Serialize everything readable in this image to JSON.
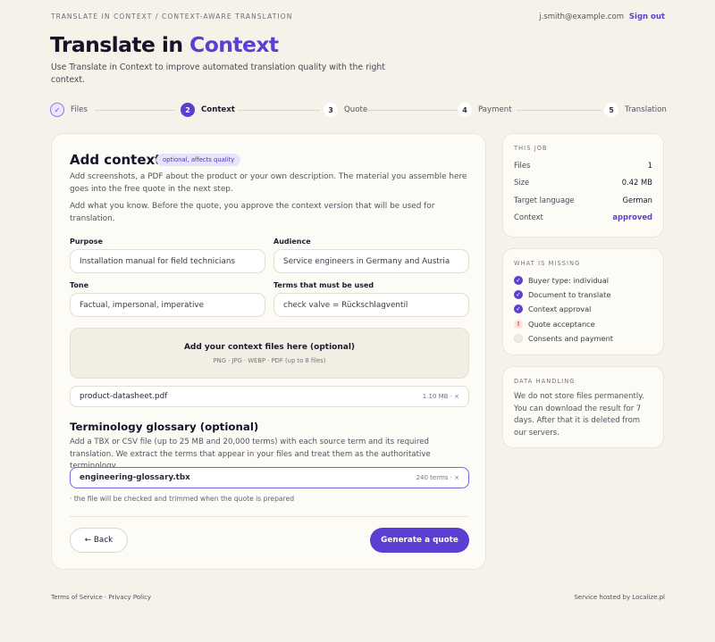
{
  "header": {
    "breadcrumb": "TRANSLATE IN CONTEXT / CONTEXT-AWARE TRANSLATION",
    "email": "j.smith@example.com",
    "signout": "Sign out"
  },
  "title": {
    "part1": "Translate in ",
    "part2": "Context"
  },
  "lede": "Use Translate in Context to improve automated translation quality with the right context.",
  "steps": [
    {
      "num": "✓",
      "label": "Files",
      "state": "done"
    },
    {
      "num": "2",
      "label": "Context",
      "state": "active"
    },
    {
      "num": "3",
      "label": "Quote",
      "state": "todo"
    },
    {
      "num": "4",
      "label": "Payment",
      "state": "todo"
    },
    {
      "num": "5",
      "label": "Translation",
      "state": "todo"
    }
  ],
  "form": {
    "heading": "Add context",
    "pill": "optional, affects quality",
    "intro1": "Add screenshots, a PDF about the product or your own description. The material you assemble here goes into the free quote in the next step.",
    "intro2": "Add what you know. Before the quote, you approve the context version that will be used for translation.",
    "purpose_label": "Purpose",
    "purpose_value": "Installation manual for field technicians",
    "audience_label": "Audience",
    "audience_value": "Service engineers in Germany and Austria",
    "tone_label": "Tone",
    "tone_value": "Factual, impersonal, imperative",
    "terms_label": "Terms that must be used",
    "terms_value": "check valve = Rückschlagventil",
    "drop_title": "Add your context files here (optional)",
    "drop_sub": "PNG · JPG · WEBP · PDF (up to 8 files)",
    "file_name": "product-datasheet.pdf",
    "file_meta": "1.10 MB · ×",
    "glossary_heading": "Terminology glossary (optional)",
    "glossary_text": "Add a TBX or CSV file (up to 25 MB and 20,000 terms) with each source term and its required translation. We extract the terms that appear in your files and treat them as the authoritative terminology.",
    "glossary_file": "engineering-glossary.tbx",
    "glossary_meta": "240 terms · ×",
    "note": "· the file will be checked and trimmed when the quote is prepared",
    "back": "← Back",
    "generate": "Generate a quote"
  },
  "job": {
    "heading": "THIS JOB",
    "rows": [
      {
        "k": "Files",
        "v": "1"
      },
      {
        "k": "Size",
        "v": "0.42 MB"
      },
      {
        "k": "Target language",
        "v": "German"
      },
      {
        "k": "Context",
        "v": "approved"
      }
    ]
  },
  "missing": {
    "heading": "WHAT IS MISSING",
    "items": [
      {
        "label": "Buyer type: individual",
        "state": "check"
      },
      {
        "label": "Document to translate",
        "state": "check"
      },
      {
        "label": "Context approval",
        "state": "check"
      },
      {
        "label": "Quote acceptance",
        "state": "warn"
      },
      {
        "label": "Consents and payment",
        "state": "empty"
      }
    ]
  },
  "handling": {
    "heading": "DATA HANDLING",
    "text": "We do not store files permanently. You can download the result for 7 days. After that it is deleted from our servers."
  },
  "footer": {
    "left": "Terms of Service · Privacy Policy",
    "right": "Service hosted by Localize.pl"
  },
  "colors": {
    "accent": "#5b3fd3",
    "background": "#f6f2ea",
    "warn": "#d64b2d"
  }
}
